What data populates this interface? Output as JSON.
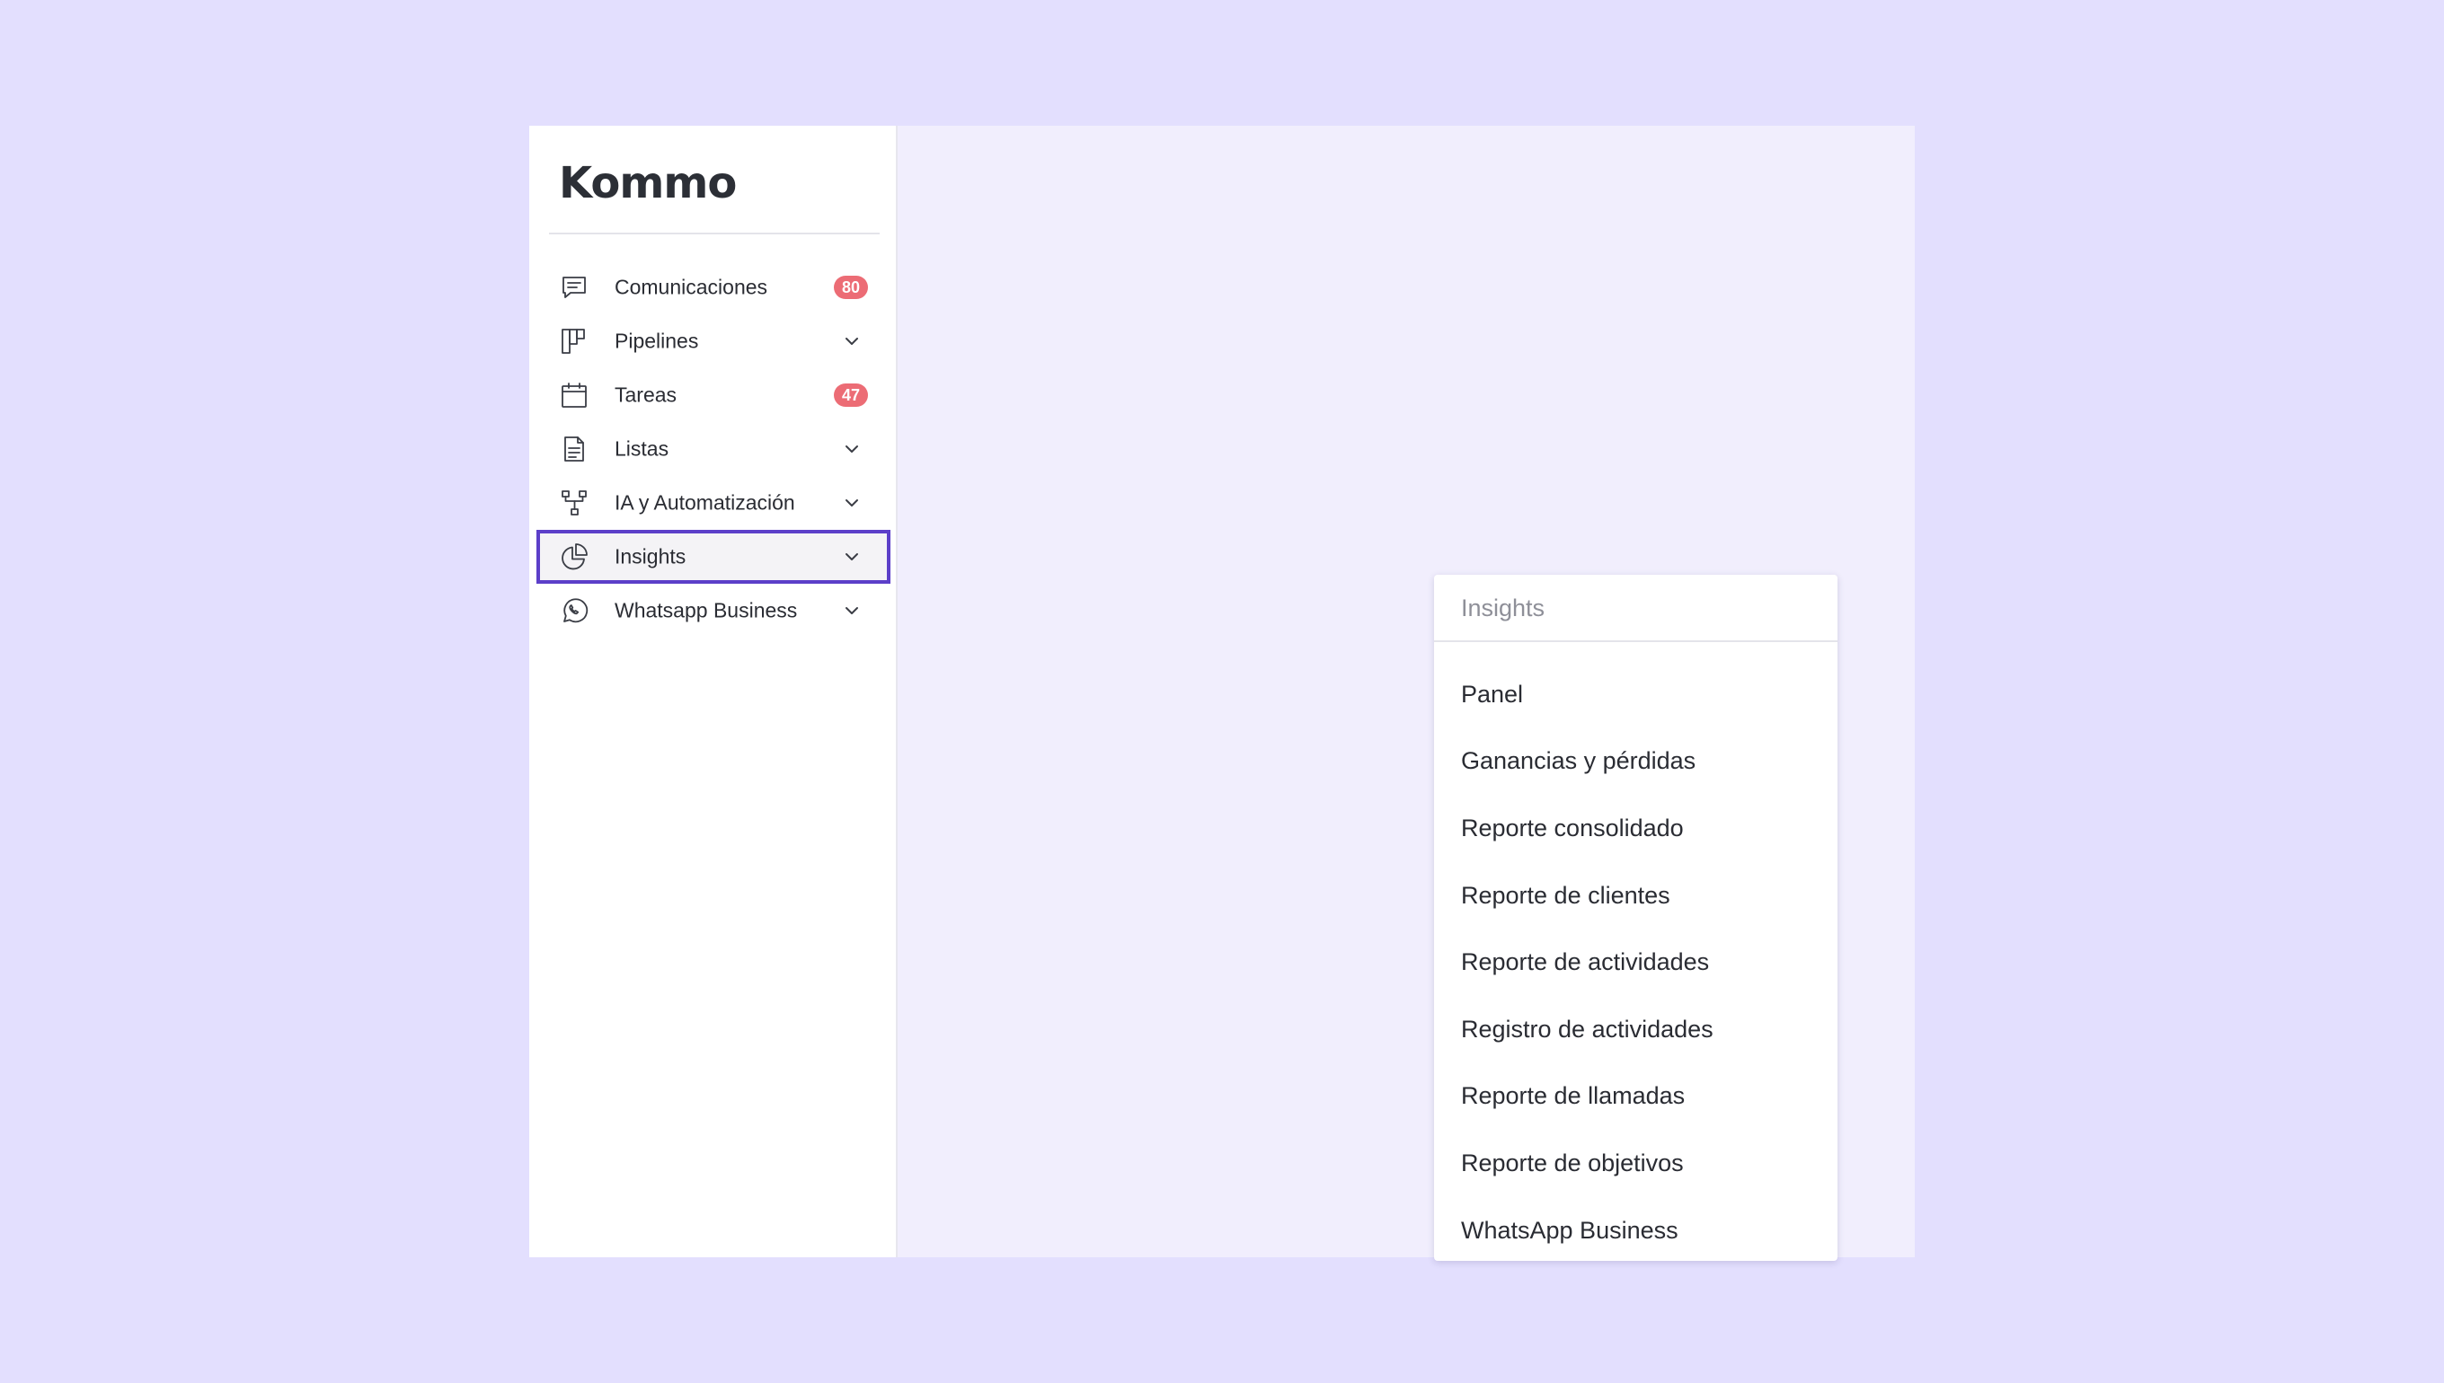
{
  "brand": {
    "logo_text": "Kommo"
  },
  "sidebar": {
    "items": [
      {
        "label": "Comunicaciones",
        "icon": "chat-icon",
        "badge": "80"
      },
      {
        "label": "Pipelines",
        "icon": "pipelines-icon",
        "expandable": true
      },
      {
        "label": "Tareas",
        "icon": "calendar-icon",
        "badge": "47"
      },
      {
        "label": "Listas",
        "icon": "document-icon",
        "expandable": true
      },
      {
        "label": "IA y Automatización",
        "icon": "automation-icon",
        "expandable": true
      },
      {
        "label": "Insights",
        "icon": "pie-chart-icon",
        "expandable": true,
        "active": true
      },
      {
        "label": "Whatsapp Business",
        "icon": "whatsapp-icon",
        "expandable": true
      }
    ]
  },
  "dropdown": {
    "title": "Insights",
    "items": [
      "Panel",
      "Ganancias y pérdidas",
      "Reporte consolidado",
      "Reporte de clientes",
      "Reporte de actividades",
      "Registro de actividades",
      "Reporte de llamadas",
      "Reporte de objetivos",
      "WhatsApp Business"
    ]
  },
  "colors": {
    "page_background": "#e3dffe",
    "content_background": "#f1eefd",
    "active_border": "#5c3fc9",
    "badge": "#ec6c75"
  }
}
